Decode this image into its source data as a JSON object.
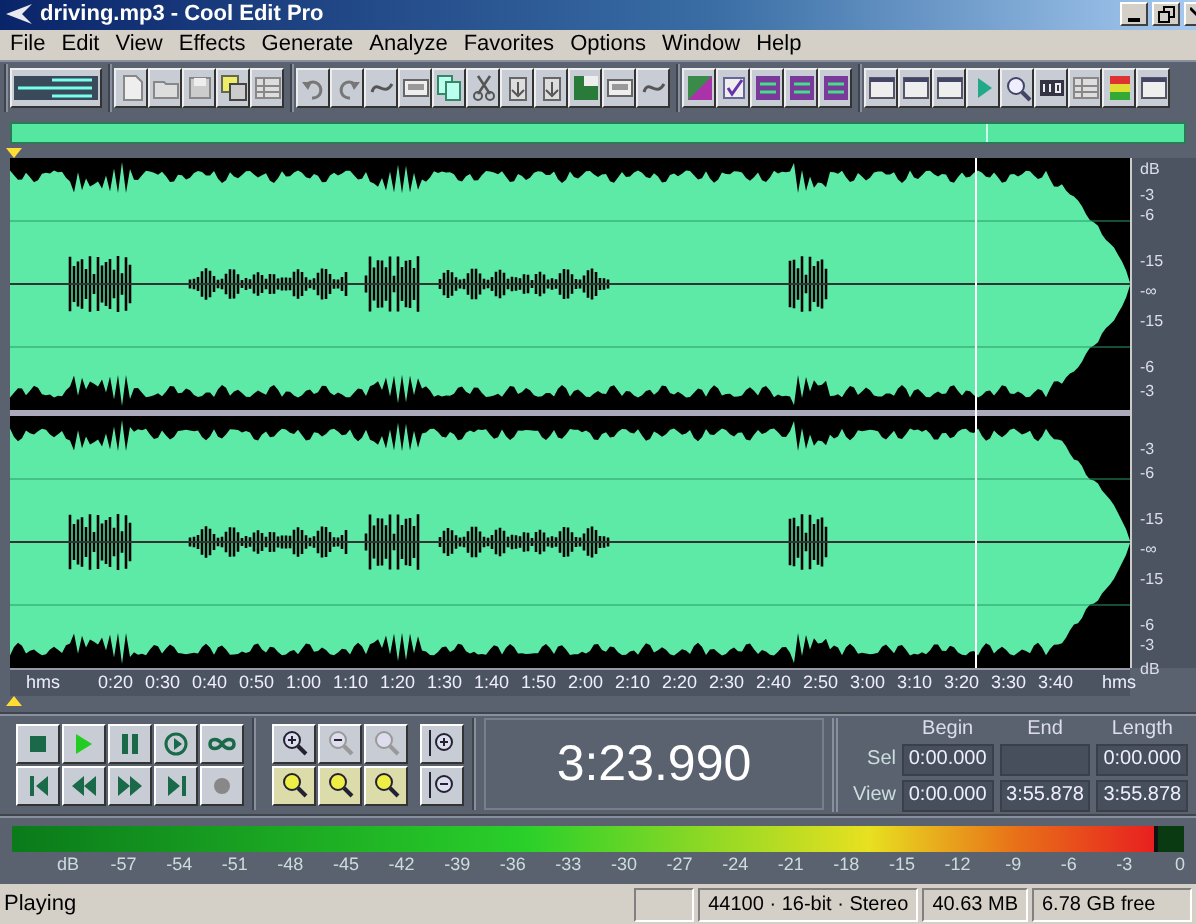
{
  "window": {
    "title": "driving.mp3 - Cool Edit Pro"
  },
  "menu": [
    "File",
    "Edit",
    "View",
    "Effects",
    "Generate",
    "Analyze",
    "Favorites",
    "Options",
    "Window",
    "Help"
  ],
  "scale": {
    "channel_1": [
      "dB",
      "-3",
      "-6",
      "-15",
      "-∞",
      "-15",
      "-6",
      "-3"
    ],
    "channel_2": [
      "-3",
      "-6",
      "-15",
      "-∞",
      "-15",
      "-6",
      "-3",
      "dB"
    ]
  },
  "ruler": {
    "unit": "hms",
    "labels": [
      "0:20",
      "0:30",
      "0:40",
      "0:50",
      "1:00",
      "1:10",
      "1:20",
      "1:30",
      "1:40",
      "1:50",
      "2:00",
      "2:10",
      "2:20",
      "2:30",
      "2:40",
      "2:50",
      "3:00",
      "3:10",
      "3:20",
      "3:30",
      "3:40"
    ],
    "unit_end": "hms"
  },
  "time_display": "3:23.990",
  "selection": {
    "headers": [
      "Begin",
      "End",
      "Length"
    ],
    "rows": [
      {
        "label": "Sel",
        "begin": "0:00.000",
        "length": "0:00.000"
      },
      {
        "label": "View",
        "begin": "0:00.000",
        "end": "3:55.878",
        "length": "3:55.878"
      }
    ]
  },
  "meter": {
    "level": 0.975,
    "labels": [
      "dB",
      "-57",
      "-54",
      "-51",
      "-48",
      "-45",
      "-42",
      "-39",
      "-36",
      "-33",
      "-30",
      "-27",
      "-24",
      "-21",
      "-18",
      "-15",
      "-12",
      "-9",
      "-6",
      "-3",
      "0"
    ]
  },
  "status_bar": {
    "state": "Playing",
    "format": "44100 · 16-bit · Stereo",
    "size": "40.63 MB",
    "free": "6.78 GB free"
  }
}
